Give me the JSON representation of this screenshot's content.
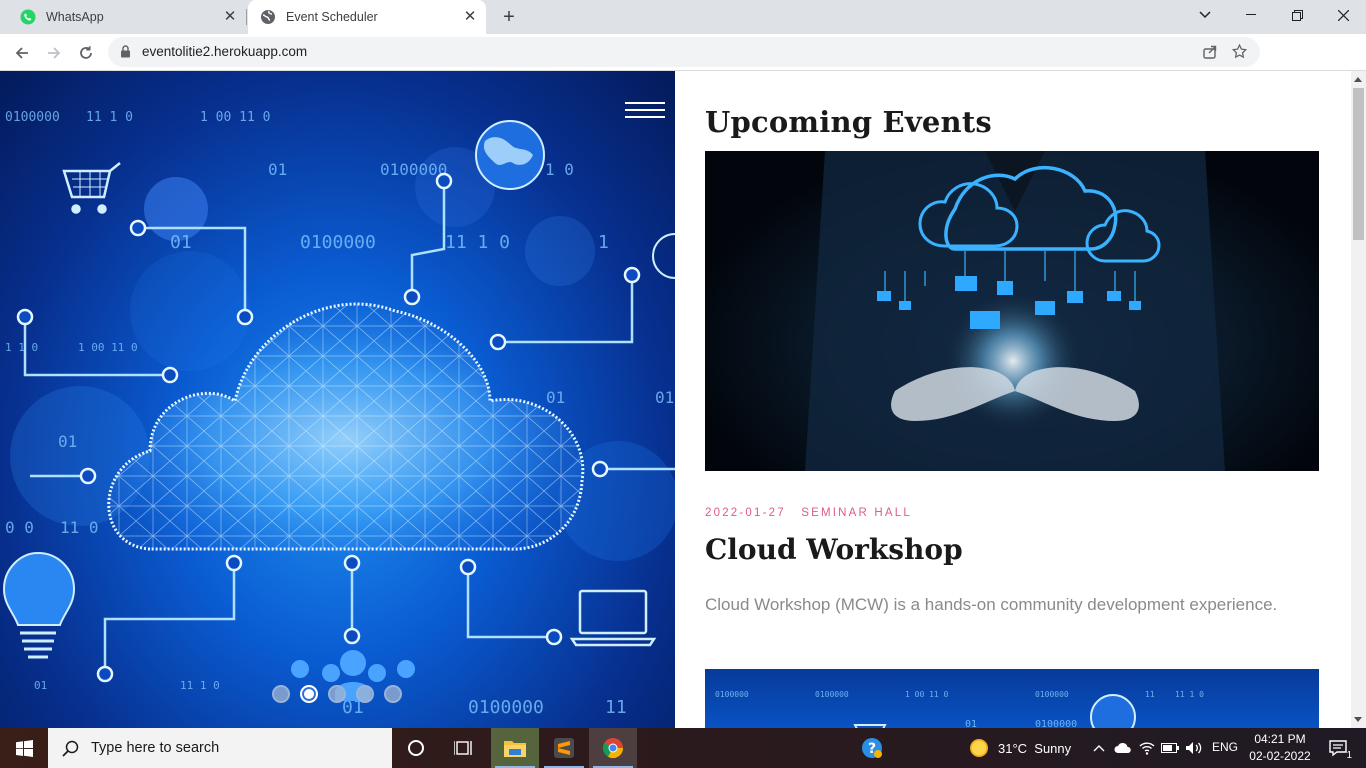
{
  "browser": {
    "tabs": [
      {
        "title": "WhatsApp",
        "icon": "whatsapp-icon"
      },
      {
        "title": "Event Scheduler",
        "icon": "globe-icon",
        "active": true
      }
    ],
    "url": "eventolitie2.herokuapp.com"
  },
  "hero": {
    "slides": 5,
    "active_slide": 2,
    "menu_icon": "hamburger-icon"
  },
  "section": {
    "title": "Upcoming Events"
  },
  "event": {
    "date": "2022-01-27",
    "venue": "SEMINAR HALL",
    "title": "Cloud Workshop",
    "description": "Cloud Workshop (MCW) is a hands-on community development experience."
  },
  "taskbar": {
    "search_placeholder": "Type here to search",
    "weather": "31°C  Sunny",
    "language": "ENG",
    "time": "04:21 PM",
    "date": "02-02-2022",
    "notifications": "1"
  },
  "colors": {
    "accent": "#e05a8a",
    "hero_blue": "#0a5bd1"
  }
}
